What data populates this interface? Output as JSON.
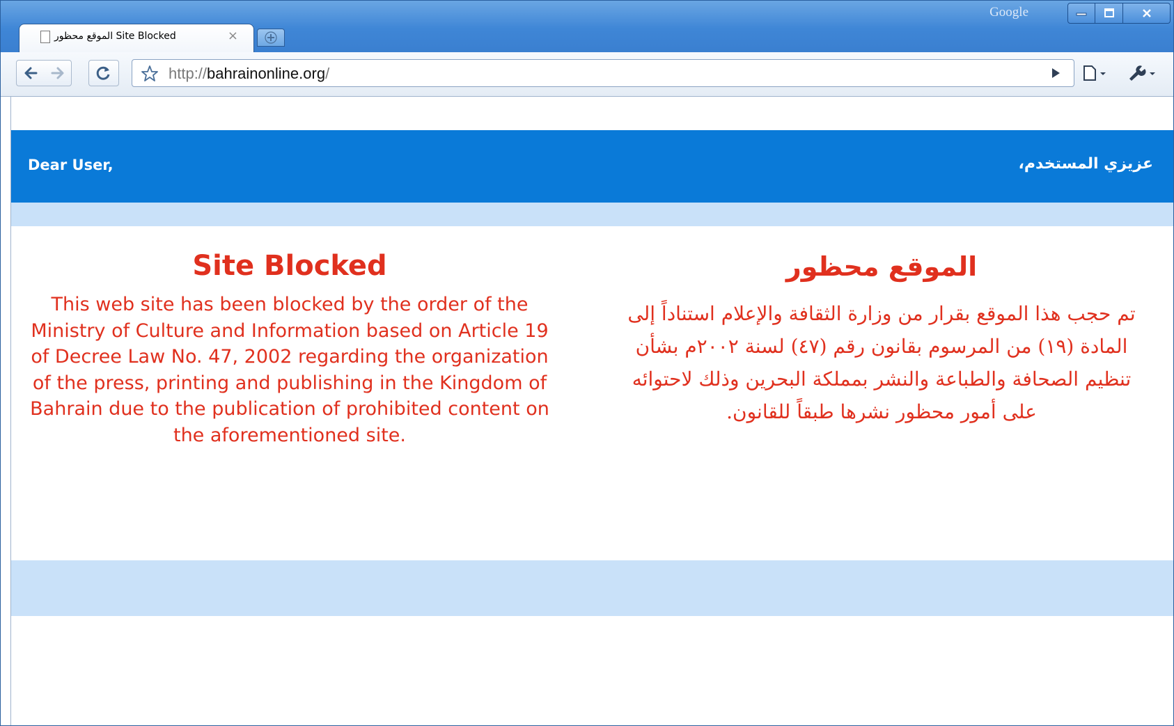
{
  "window": {
    "brand_label": "Google",
    "minimize_icon": "minimize-icon",
    "maximize_icon": "maximize-icon",
    "close_icon": "close-icon"
  },
  "tab": {
    "title": "الموقع محظور Site Blocked",
    "close_glyph": "×",
    "icon": "page-icon"
  },
  "toolbar": {
    "back_icon": "back-arrow-icon",
    "forward_icon": "forward-arrow-icon",
    "reload_icon": "reload-icon",
    "star_icon": "star-icon",
    "go_icon": "play-icon",
    "page_menu_icon": "page-menu-icon",
    "wrench_icon": "wrench-icon"
  },
  "address": {
    "scheme": "http://",
    "host": "bahrainonline.org",
    "trailing": "/"
  },
  "page": {
    "greeting_en": "Dear User,",
    "greeting_ar": "عزيزي المستخدم،",
    "heading_en": "Site Blocked",
    "heading_ar": "الموقع محظور",
    "body_en": "This web site has been blocked by the order of the Ministry of Culture and Information based on Article 19 of Decree Law No. 47, 2002 regarding the organization of the press, printing and publishing in the Kingdom of Bahrain due to the publication of prohibited content on the aforementioned site.",
    "body_ar": "تم حجب هذا الموقع بقرار من وزارة الثقافة والإعلام استناداً إلى المادة (١٩) من المرسوم بقانون رقم (٤٧) لسنة ٢٠٠٢م بشأن تنظيم الصحافة والطباعة والنشر بمملكة البحرين وذلك لاحتوائه على أمور محظور نشرها طبقاً للقانون."
  },
  "colors": {
    "header_blue": "#0a7ad8",
    "light_band": "#c9e1f9",
    "message_red": "#e0301e",
    "chrome_blue": "#3f86d6"
  }
}
